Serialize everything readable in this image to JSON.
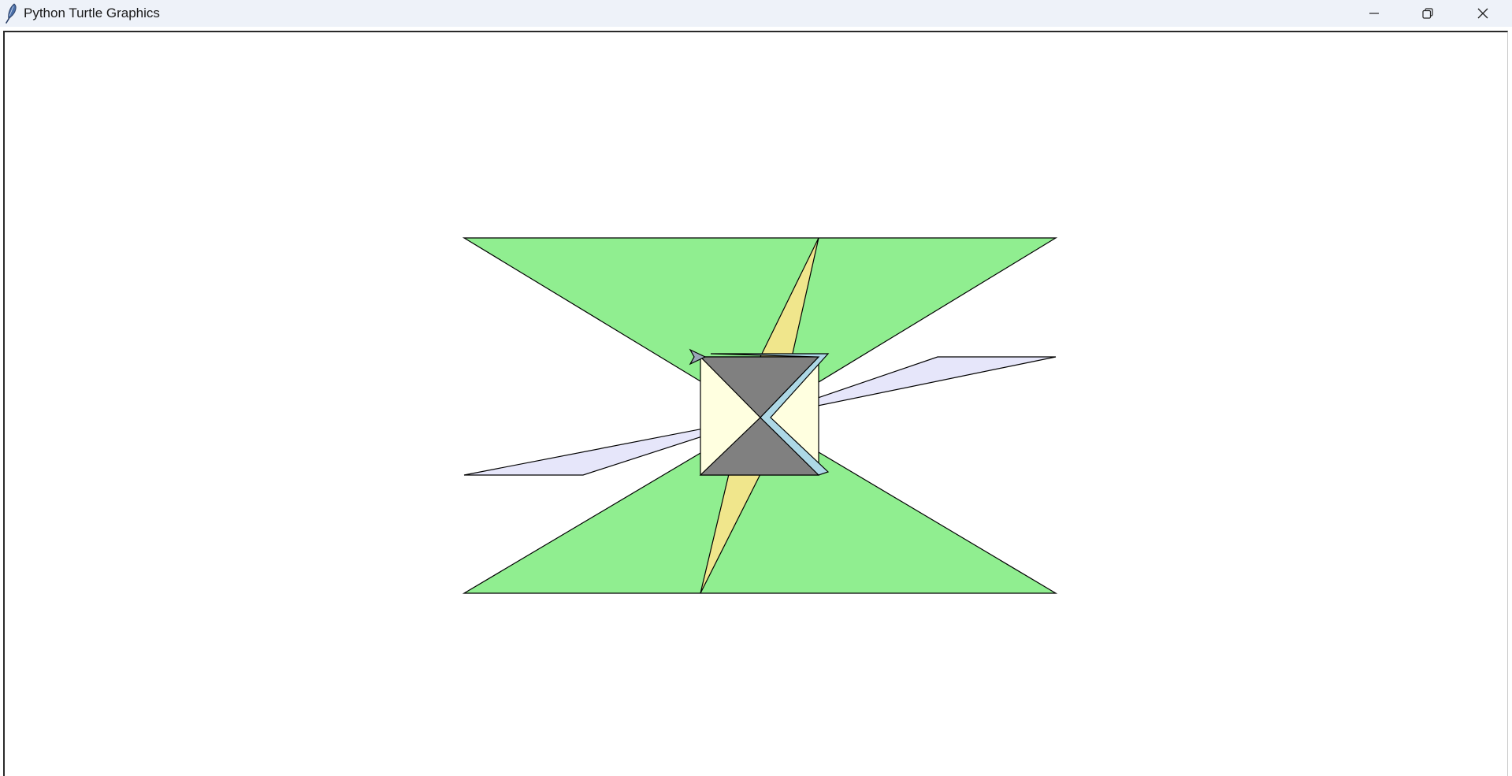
{
  "window": {
    "title": "Python Turtle Graphics",
    "icon": "feather-icon",
    "controls": {
      "minimize_icon": "minimize-icon",
      "restore_icon": "restore-icon",
      "close_icon": "close-icon"
    }
  },
  "canvas": {
    "background": "#ffffff",
    "outline_color": "#000000",
    "shapes": [
      {
        "name": "green-triangle-top",
        "fill": "#90ee90"
      },
      {
        "name": "green-triangle-bottom",
        "fill": "#90ee90"
      },
      {
        "name": "khaki-sliver-upper",
        "fill": "#f0e68c"
      },
      {
        "name": "khaki-sliver-lower",
        "fill": "#f0e68c"
      },
      {
        "name": "lavender-sliver-left",
        "fill": "#e6e6fa"
      },
      {
        "name": "lavender-sliver-right",
        "fill": "#e6e6fa"
      },
      {
        "name": "cream-square",
        "fill": "#ffffe0"
      },
      {
        "name": "gray-triangle-top",
        "fill": "#808080"
      },
      {
        "name": "gray-triangle-bottom",
        "fill": "#808080"
      },
      {
        "name": "lightblue-chevron",
        "fill": "#add8e6"
      }
    ],
    "turtle_cursor": "turtle-arrow-icon"
  }
}
